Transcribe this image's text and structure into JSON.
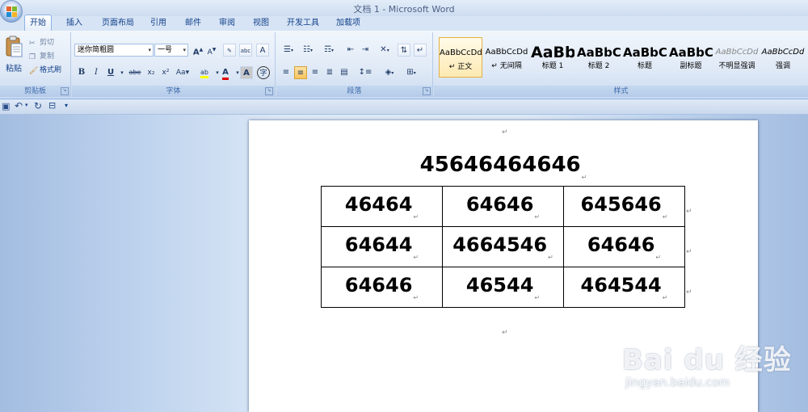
{
  "window": {
    "title": "文档 1 - Microsoft Word"
  },
  "tabs": [
    {
      "label": "开始",
      "active": true
    },
    {
      "label": "插入"
    },
    {
      "label": "页面布局"
    },
    {
      "label": "引用"
    },
    {
      "label": "邮件"
    },
    {
      "label": "审阅"
    },
    {
      "label": "视图"
    },
    {
      "label": "开发工具"
    },
    {
      "label": "加载项"
    }
  ],
  "clipboard": {
    "group_label": "剪贴板",
    "paste_label": "粘贴",
    "cut_label": "剪切",
    "copy_label": "复制",
    "format_painter_label": "格式刷"
  },
  "font": {
    "group_label": "字体",
    "font_name": "迷你简粗圆",
    "font_size": "一号",
    "grow": "A",
    "shrink": "A",
    "phonetic": "abc",
    "char_border": "A",
    "bold": "B",
    "italic": "I",
    "underline": "U",
    "strike": "abe",
    "subscript": "x₂",
    "superscript": "x²",
    "change_case": "Aa",
    "highlight": "ab",
    "font_color": "A",
    "char_shading": "A",
    "enclose": "字"
  },
  "paragraph": {
    "group_label": "段落"
  },
  "styles": {
    "group_label": "样式",
    "items": [
      {
        "sample": "AaBbCcDd",
        "name": "↵ 正文",
        "selected": true
      },
      {
        "sample": "AaBbCcDd",
        "name": "↵ 无间隔"
      },
      {
        "sample": "AaBb",
        "name": "标题 1"
      },
      {
        "sample": "AaBbC",
        "name": "标题 2"
      },
      {
        "sample": "AaBbC",
        "name": "标题"
      },
      {
        "sample": "AaBbC",
        "name": "副标题"
      },
      {
        "sample": "AaBbCcDd",
        "name": "不明显强调"
      },
      {
        "sample": "AaBbCcDd",
        "name": "强调"
      }
    ]
  },
  "document": {
    "paragraph_mark": "↵",
    "title": "45646464646",
    "table": [
      [
        "46464",
        "64646",
        "645646"
      ],
      [
        "64644",
        "4664546",
        "64646"
      ],
      [
        "64646",
        "46544",
        "464544"
      ]
    ]
  },
  "watermark": {
    "brand": "Bai du 经验",
    "url": "jingyan.baidu.com"
  },
  "colors": {
    "ribbon_blue": "#15428b",
    "selected_style": "#fde9b2",
    "font_color_red": "#e00000",
    "highlight_yellow": "#ffff00"
  }
}
